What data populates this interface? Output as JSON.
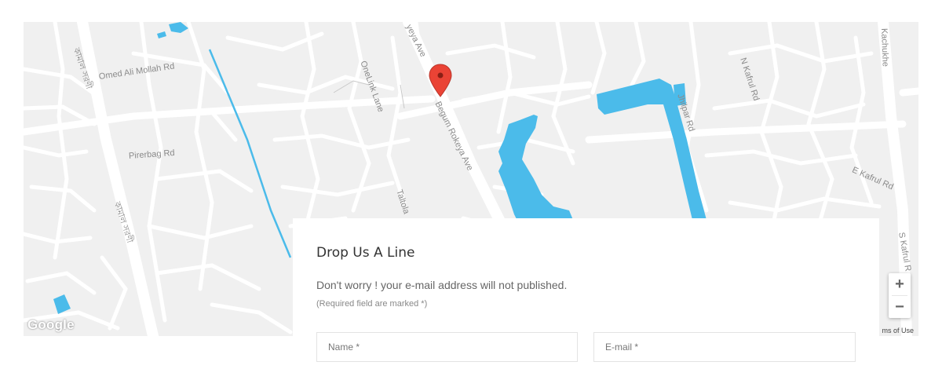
{
  "map": {
    "google_label": "Google",
    "terms_label": "ms of Use",
    "zoom_in_label": "+",
    "zoom_out_label": "−",
    "road_labels": [
      "Omed Ali Mollah Rd",
      "OneLink Lane",
      "Begum Rokeya Ave",
      "Pirerbag Rd",
      "Taltola",
      "Jhilpar Rd",
      "N Kafrul Rd",
      "E Kafrul Rd",
      "S Kafrul R",
      "Kachukhe",
      "yeya Ave",
      "কামাল সরণী",
      "কামাল সরণী"
    ],
    "colors": {
      "water": "#4bbbea",
      "road": "#ffffff",
      "land": "#f0f0f0",
      "pin": "#ea4335"
    }
  },
  "form": {
    "title": "Drop Us A Line",
    "subtitle": "Don't worry ! your e-mail address will not published.",
    "note": "(Required field are marked *)",
    "name_placeholder": "Name *",
    "email_placeholder": "E-mail *"
  }
}
